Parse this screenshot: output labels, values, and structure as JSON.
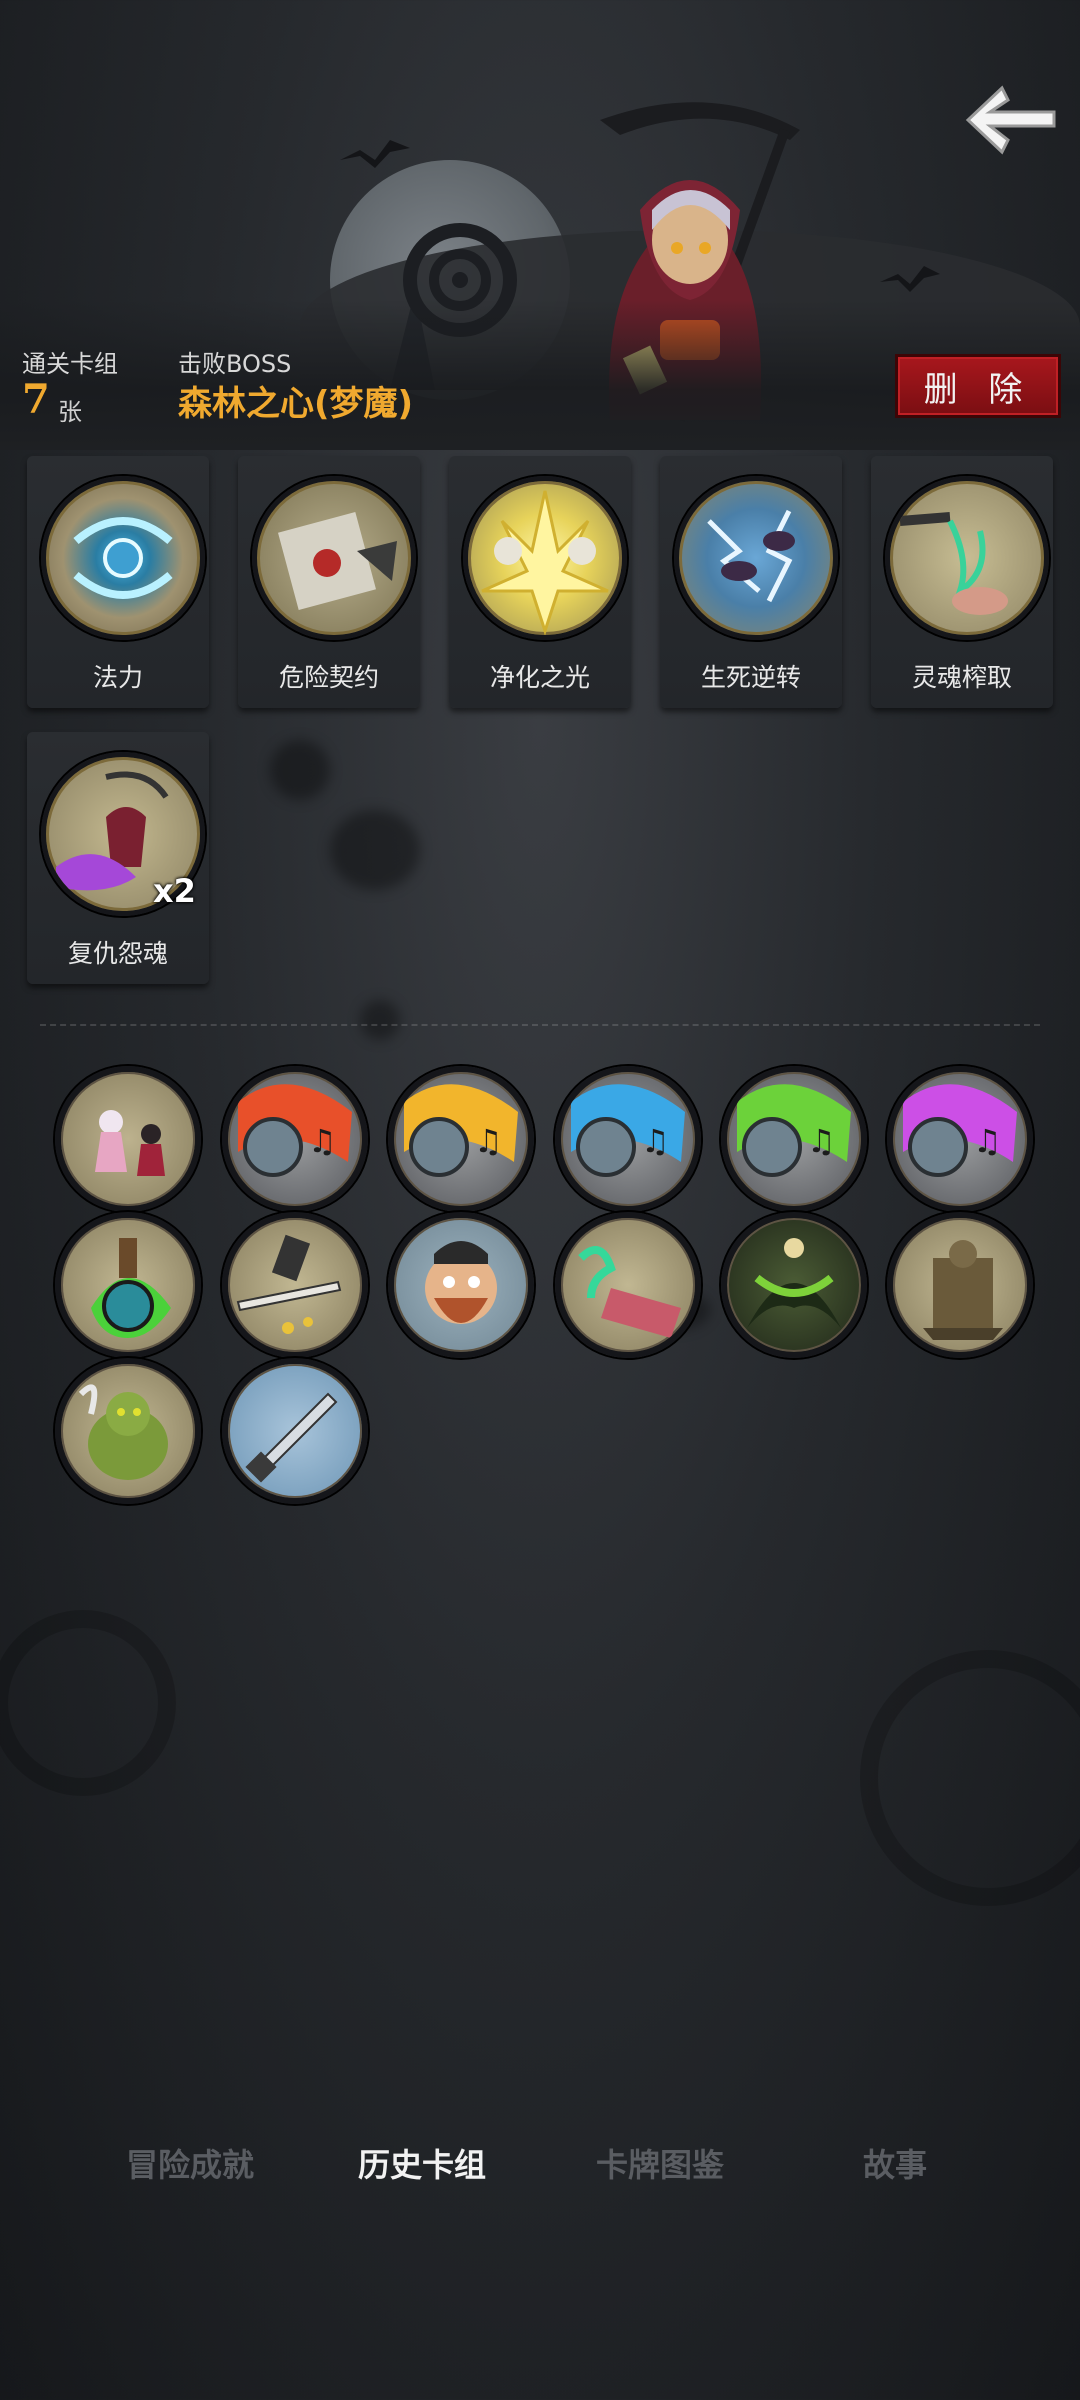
{
  "header": {
    "deck_label": "通关卡组",
    "deck_count": "7",
    "deck_unit": "张",
    "boss_label": "击败BOSS",
    "boss_name": "森林之心(梦魔)",
    "delete_label": "删 除"
  },
  "cards": [
    {
      "name": "法力",
      "icon": "mana-swirl",
      "count": ""
    },
    {
      "name": "危险契约",
      "icon": "contract-scroll",
      "count": ""
    },
    {
      "name": "净化之光",
      "icon": "holy-light",
      "count": ""
    },
    {
      "name": "生死逆转",
      "icon": "lightning-ghosts",
      "count": ""
    },
    {
      "name": "灵魂榨取",
      "icon": "soul-drain",
      "count": ""
    },
    {
      "name": "复仇怨魂",
      "icon": "vengeful-spirit",
      "count": "x2"
    }
  ],
  "relics": [
    {
      "icon": "dancers-relic"
    },
    {
      "icon": "skull-horn-red"
    },
    {
      "icon": "skull-horn-yellow"
    },
    {
      "icon": "skull-horn-blue"
    },
    {
      "icon": "skull-horn-green"
    },
    {
      "icon": "skull-horn-purple"
    },
    {
      "icon": "potion-relic"
    },
    {
      "icon": "sword-relic"
    },
    {
      "icon": "bearded-man-relic"
    },
    {
      "icon": "ghost-bed-relic"
    },
    {
      "icon": "green-specter-relic"
    },
    {
      "icon": "stone-statue-relic"
    },
    {
      "icon": "ogre-relic"
    },
    {
      "icon": "dagger-relic"
    }
  ],
  "tabs": [
    {
      "label": "冒险成就",
      "active": false
    },
    {
      "label": "历史卡组",
      "active": true
    },
    {
      "label": "卡牌图鉴",
      "active": false
    },
    {
      "label": "故事",
      "active": false
    }
  ]
}
